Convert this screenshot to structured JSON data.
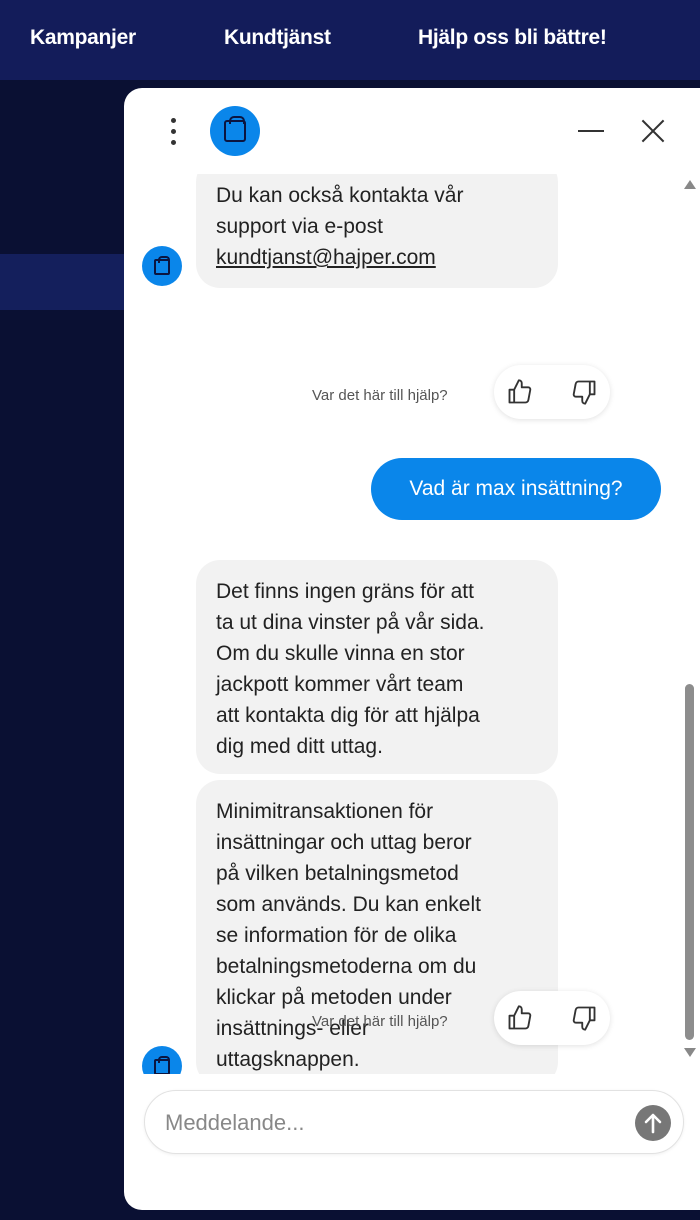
{
  "nav": {
    "items": [
      "Kampanjer",
      "Kundtjänst",
      "Hjälp oss bli bättre!"
    ]
  },
  "colors": {
    "nav_bg": "#131c5a",
    "page_bg": "#0a1033",
    "accent": "#0a86ea",
    "bot_bubble": "#f2f2f2"
  },
  "chat": {
    "header": {
      "menu_icon": "kebab-menu-icon",
      "avatar_icon": "bot-avatar-icon",
      "minimize_icon": "minimize-icon",
      "close_icon": "close-icon"
    },
    "messages": [
      {
        "from": "bot",
        "lines": [
          "Du kan också kontakta vår",
          "support via e-post"
        ],
        "link": "kundtjanst@hajper.com"
      },
      {
        "from": "user",
        "text": "Vad är max insättning?"
      },
      {
        "from": "bot",
        "lines": [
          "Det finns ingen gräns för att",
          "ta ut dina vinster på vår sida.",
          "Om du skulle vinna en stor",
          "jackpott kommer vårt team",
          "att kontakta dig för att hjälpa",
          "dig med ditt uttag."
        ]
      },
      {
        "from": "bot",
        "lines": [
          "Minimitransaktionen för",
          "insättningar och uttag beror",
          "på vilken betalningsmetod",
          "som används. Du kan enkelt",
          "se information för de olika",
          "betalningsmetoderna om du",
          "klickar på metoden under",
          "insättnings- eller",
          "uttagsknappen."
        ]
      }
    ],
    "feedback_label": "Var det här till hjälp?",
    "input": {
      "placeholder": "Meddelande...",
      "value": ""
    }
  }
}
